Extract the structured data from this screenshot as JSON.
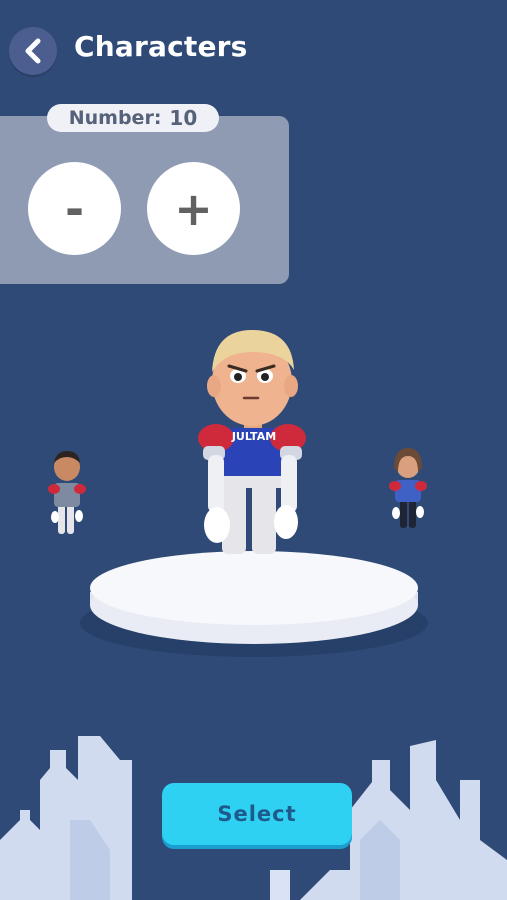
{
  "header": {
    "title": "Characters"
  },
  "counter": {
    "label": "Number:",
    "value": "10",
    "minus_label": "-",
    "plus_label": "+"
  },
  "character": {
    "jersey_text": "JULTAM"
  },
  "footer": {
    "select_label": "Select"
  },
  "colors": {
    "background": "#2f4a76",
    "panel": "#8e9bb3",
    "button_accent": "#2fd1f3"
  }
}
